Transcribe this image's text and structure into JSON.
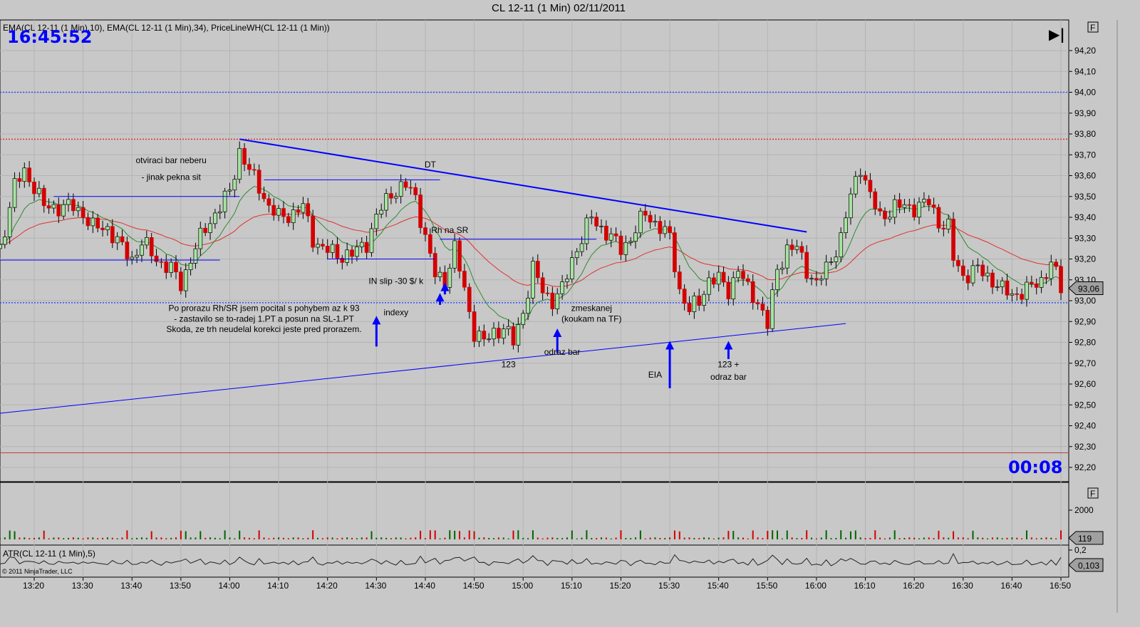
{
  "window": {
    "title": "CL 12-11 (1 Min)  02/11/2011"
  },
  "indicator_label": "EMA(CL 12-11 (1 Min),10), EMA(CL 12-11 (1 Min),34), PriceLineWH(CL 12-11 (1 Min))",
  "clock": "16:45:52",
  "bar_timer": "00:08",
  "buttons": {
    "scroll_end": "▶|",
    "panel_f": "F",
    "volume_f": "F"
  },
  "copyright": "© 2011 NinjaTrader, LLC",
  "atr_label": "ATR(CL 12-11 (1 Min),5)",
  "colors": {
    "up": "#a6e3a0",
    "down": "#d40000",
    "ema10": "#2e8b2e",
    "ema34": "#e03030",
    "lines": "#0000ff",
    "bg": "#c8c8c8"
  },
  "chart_data": {
    "type": "candlestick",
    "symbol": "CL 12-11",
    "interval_min": 1,
    "price_axis": {
      "min": 92.15,
      "max": 94.28,
      "ticks": [
        "94,20",
        "94,10",
        "94,00",
        "93,90",
        "93,80",
        "93,70",
        "93,60",
        "93,50",
        "93,40",
        "93,30",
        "93,20",
        "93,10",
        "93,00",
        "92,90",
        "92,80",
        "92,70",
        "92,60",
        "92,50",
        "92,40",
        "92,30",
        "92,20"
      ]
    },
    "time_ticks": [
      "13:20",
      "13:30",
      "13:40",
      "13:50",
      "14:00",
      "14:10",
      "14:20",
      "14:30",
      "14:40",
      "14:50",
      "15:00",
      "15:10",
      "15:20",
      "15:30",
      "15:40",
      "15:50",
      "16:00",
      "16:10",
      "16:20",
      "16:30",
      "16:40",
      "16:50"
    ],
    "close_waypoints": [
      [
        "13:13",
        93.25
      ],
      [
        "13:16",
        93.55
      ],
      [
        "13:18",
        93.62
      ],
      [
        "13:20",
        93.55
      ],
      [
        "13:22",
        93.45
      ],
      [
        "13:28",
        93.45
      ],
      [
        "13:30",
        93.42
      ],
      [
        "13:32",
        93.35
      ],
      [
        "13:35",
        93.35
      ],
      [
        "13:38",
        93.25
      ],
      [
        "13:40",
        93.2
      ],
      [
        "13:42",
        93.28
      ],
      [
        "13:45",
        93.2
      ],
      [
        "13:48",
        93.15
      ],
      [
        "13:50",
        93.08
      ],
      [
        "13:52",
        93.2
      ],
      [
        "13:55",
        93.35
      ],
      [
        "13:58",
        93.45
      ],
      [
        "14:00",
        93.52
      ],
      [
        "14:02",
        93.72
      ],
      [
        "14:04",
        93.62
      ],
      [
        "14:06",
        93.55
      ],
      [
        "14:08",
        93.45
      ],
      [
        "14:10",
        93.4
      ],
      [
        "14:13",
        93.42
      ],
      [
        "14:15",
        93.45
      ],
      [
        "14:17",
        93.3
      ],
      [
        "14:19",
        93.25
      ],
      [
        "14:22",
        93.22
      ],
      [
        "14:25",
        93.22
      ],
      [
        "14:28",
        93.28
      ],
      [
        "14:30",
        93.4
      ],
      [
        "14:33",
        93.52
      ],
      [
        "14:36",
        93.55
      ],
      [
        "14:38",
        93.5
      ],
      [
        "14:40",
        93.3
      ],
      [
        "14:42",
        93.12
      ],
      [
        "14:44",
        93.1
      ],
      [
        "14:46",
        93.25
      ],
      [
        "14:48",
        93.05
      ],
      [
        "14:50",
        92.85
      ],
      [
        "14:52",
        92.8
      ],
      [
        "14:54",
        92.85
      ],
      [
        "14:56",
        92.87
      ],
      [
        "14:58",
        92.8
      ],
      [
        "15:00",
        92.95
      ],
      [
        "15:02",
        93.15
      ],
      [
        "15:04",
        93.05
      ],
      [
        "15:06",
        93.0
      ],
      [
        "15:08",
        93.05
      ],
      [
        "15:10",
        93.2
      ],
      [
        "15:12",
        93.3
      ],
      [
        "15:14",
        93.4
      ],
      [
        "15:16",
        93.35
      ],
      [
        "15:18",
        93.3
      ],
      [
        "15:20",
        93.25
      ],
      [
        "15:22",
        93.3
      ],
      [
        "15:25",
        93.42
      ],
      [
        "15:28",
        93.35
      ],
      [
        "15:30",
        93.3
      ],
      [
        "15:32",
        93.05
      ],
      [
        "15:34",
        92.95
      ],
      [
        "15:36",
        93.0
      ],
      [
        "15:38",
        93.1
      ],
      [
        "15:40",
        93.1
      ],
      [
        "15:42",
        93.05
      ],
      [
        "15:44",
        93.15
      ],
      [
        "15:46",
        93.05
      ],
      [
        "15:48",
        93.0
      ],
      [
        "15:50",
        92.88
      ],
      [
        "15:52",
        93.15
      ],
      [
        "15:54",
        93.25
      ],
      [
        "15:56",
        93.25
      ],
      [
        "15:58",
        93.15
      ],
      [
        "16:00",
        93.08
      ],
      [
        "16:02",
        93.15
      ],
      [
        "16:05",
        93.3
      ],
      [
        "16:07",
        93.5
      ],
      [
        "16:09",
        93.65
      ],
      [
        "16:11",
        93.5
      ],
      [
        "16:13",
        93.4
      ],
      [
        "16:16",
        93.45
      ],
      [
        "16:20",
        93.45
      ],
      [
        "16:23",
        93.47
      ],
      [
        "16:25",
        93.38
      ],
      [
        "16:27",
        93.35
      ],
      [
        "16:28",
        93.2
      ],
      [
        "16:30",
        93.12
      ],
      [
        "16:33",
        93.15
      ],
      [
        "16:36",
        93.1
      ],
      [
        "16:38",
        93.05
      ],
      [
        "16:40",
        93.03
      ],
      [
        "16:43",
        93.05
      ],
      [
        "16:46",
        93.1
      ],
      [
        "16:48",
        93.18
      ],
      [
        "16:50",
        93.06
      ]
    ],
    "last_price": "93,06",
    "horizontal_lines": [
      {
        "price": 94.0,
        "style": "dotted",
        "color": "#3050ff"
      },
      {
        "price": 93.775,
        "style": "dotted",
        "color": "#e03030"
      },
      {
        "price": 92.99,
        "style": "dotted",
        "color": "#3050ff"
      },
      {
        "price": 92.27,
        "style": "solid",
        "color": "#c04040"
      }
    ],
    "trend_lines": [
      {
        "name": "dt-line",
        "from": [
          "14:02",
          93.775
        ],
        "to": [
          "15:58",
          93.33
        ],
        "width": 2
      },
      {
        "name": "support-line",
        "from": [
          "13:13",
          92.46
        ],
        "to": [
          "16:06",
          92.89
        ],
        "width": 1
      },
      {
        "name": "sr-1",
        "from": [
          "13:13",
          93.195
        ],
        "to": [
          "13:58",
          93.195
        ],
        "width": 1
      },
      {
        "name": "sr-2",
        "from": [
          "13:24",
          93.5
        ],
        "to": [
          "14:02",
          93.5
        ],
        "width": 1
      },
      {
        "name": "sr-3",
        "from": [
          "14:07",
          93.58
        ],
        "to": [
          "14:43",
          93.58
        ],
        "width": 1
      },
      {
        "name": "sr-4",
        "from": [
          "14:20",
          93.2
        ],
        "to": [
          "14:42",
          93.2
        ],
        "width": 1
      },
      {
        "name": "sr-5",
        "from": [
          "14:43",
          93.295
        ],
        "to": [
          "15:15",
          93.295
        ],
        "width": 1
      }
    ],
    "annotations": [
      {
        "text": "otviraci bar neberu",
        "at": [
          "13:48",
          93.66
        ]
      },
      {
        "text": "- jinak pekna sit",
        "at": [
          "13:48",
          93.58
        ]
      },
      {
        "text": "DT",
        "at": [
          "14:41",
          93.64
        ]
      },
      {
        "text": "Rh na SR",
        "at": [
          "14:45",
          93.325
        ]
      },
      {
        "text": "IN slip -30 $/ k",
        "at": [
          "14:34",
          93.08
        ]
      },
      {
        "text": "Po prorazu Rh/SR jsem pocital s pohybem az k 93",
        "at": [
          "14:07",
          92.95
        ]
      },
      {
        "text": "- zastavilo se to-radej 1.PT a posun na SL-1.PT",
        "at": [
          "14:07",
          92.9
        ]
      },
      {
        "text": "Skoda, ze trh neudelal korekci jeste pred prorazem.",
        "at": [
          "14:07",
          92.85
        ]
      },
      {
        "text": "indexy",
        "at": [
          "14:34",
          92.93
        ]
      },
      {
        "text": "123",
        "at": [
          "14:57",
          92.68
        ]
      },
      {
        "text": "odraz bar",
        "at": [
          "15:08",
          92.74
        ]
      },
      {
        "text": "zmeskanej",
        "at": [
          "15:14",
          92.95
        ]
      },
      {
        "text": "(koukam na TF)",
        "at": [
          "15:14",
          92.9
        ]
      },
      {
        "text": "EIA",
        "at": [
          "15:27",
          92.63
        ]
      },
      {
        "text": "123 +",
        "at": [
          "15:42",
          92.68
        ]
      },
      {
        "text": "odraz bar",
        "at": [
          "15:42",
          92.62
        ]
      }
    ],
    "arrows": [
      [
        "14:30",
        92.78,
        92.92
      ],
      [
        "15:07",
        92.75,
        92.86
      ],
      [
        "15:30",
        92.58,
        92.8
      ],
      [
        "15:42",
        92.72,
        92.8
      ],
      [
        "14:43",
        92.98,
        93.03
      ],
      [
        "14:44",
        93.03,
        93.08
      ]
    ],
    "volume": {
      "axis_tick": "2000",
      "last": "119"
    },
    "atr": {
      "axis_tick": "0,2",
      "last": "0,103"
    }
  }
}
